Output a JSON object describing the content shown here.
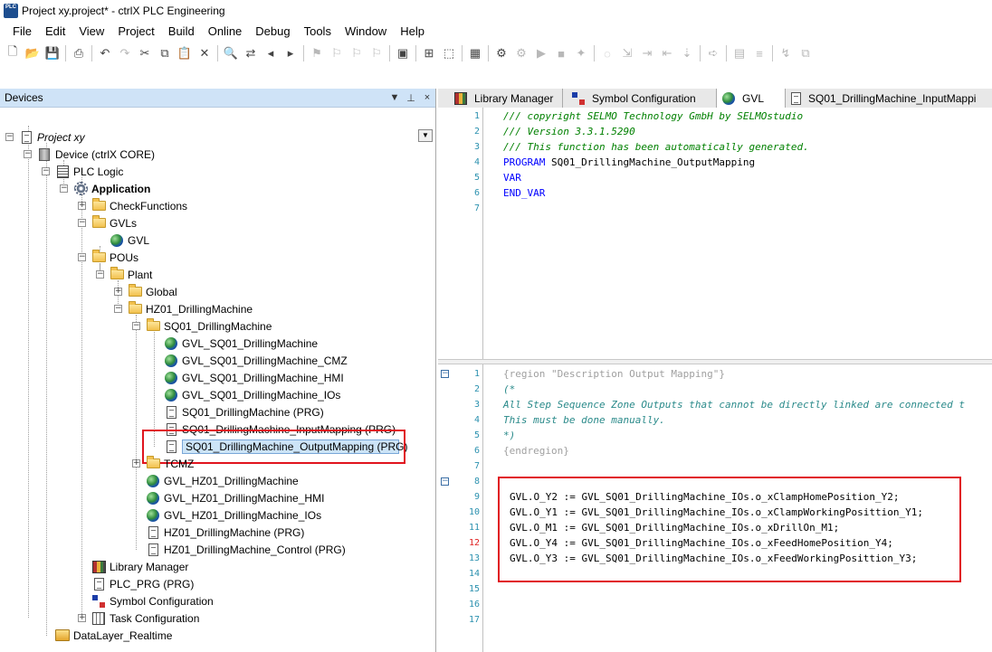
{
  "window": {
    "title": "Project xy.project* - ctrlX PLC Engineering",
    "app_icon_text": "PLC"
  },
  "menu": [
    "File",
    "Edit",
    "View",
    "Project",
    "Build",
    "Online",
    "Debug",
    "Tools",
    "Window",
    "Help"
  ],
  "devices": {
    "title": "Devices",
    "controls": {
      "dropdown": "▼",
      "pin": "⊥",
      "close": "×"
    },
    "dropdown_arrow": "▼",
    "tree": {
      "project": "Project xy",
      "device": "Device (ctrlX CORE)",
      "plc_logic": "PLC Logic",
      "application": "Application",
      "check_functions": "CheckFunctions",
      "gvls": "GVLs",
      "gvl": "GVL",
      "pous": "POUs",
      "plant": "Plant",
      "global": "Global",
      "hz01": "HZ01_DrillingMachine",
      "sq01": "SQ01_DrillingMachine",
      "gvl_sq01": "GVL_SQ01_DrillingMachine",
      "gvl_sq01_cmz": "GVL_SQ01_DrillingMachine_CMZ",
      "gvl_sq01_hmi": "GVL_SQ01_DrillingMachine_HMI",
      "gvl_sq01_ios": "GVL_SQ01_DrillingMachine_IOs",
      "sq01_prg": "SQ01_DrillingMachine (PRG)",
      "sq01_input": "SQ01_DrillingMachine_InputMapping (PRG)",
      "sq01_output": "SQ01_DrillingMachine_OutputMapping (PRG)",
      "tcmz": "TCMZ",
      "gvl_hz01": "GVL_HZ01_DrillingMachine",
      "gvl_hz01_hmi": "GVL_HZ01_DrillingMachine_HMI",
      "gvl_hz01_ios": "GVL_HZ01_DrillingMachine_IOs",
      "hz01_prg": "HZ01_DrillingMachine (PRG)",
      "hz01_control": "HZ01_DrillingMachine_Control (PRG)",
      "library_manager": "Library Manager",
      "plc_prg": "PLC_PRG (PRG)",
      "symbol_config": "Symbol Configuration",
      "task_config": "Task Configuration",
      "datalayer": "DataLayer_Realtime"
    }
  },
  "tabs": [
    {
      "label": "Library Manager",
      "icon": "library-icon"
    },
    {
      "label": "Symbol Configuration",
      "icon": "symbol-icon"
    },
    {
      "label": "GVL",
      "icon": "globe-icon"
    },
    {
      "label": "SQ01_DrillingMachine_InputMappi",
      "icon": "document-icon"
    }
  ],
  "declaration": {
    "lines": [
      {
        "n": "1",
        "text": "/// copyright SELMO Technology GmbH by SELMOstudio"
      },
      {
        "n": "2",
        "text": "/// Version 3.3.1.5290"
      },
      {
        "n": "3",
        "text": "/// This function has been automatically generated."
      },
      {
        "n": "4",
        "kw": "PROGRAM",
        "text": " SQ01_DrillingMachine_OutputMapping"
      },
      {
        "n": "5",
        "kw": "VAR",
        "text": ""
      },
      {
        "n": "6",
        "kw": "END_VAR",
        "text": ""
      },
      {
        "n": "7",
        "text": ""
      }
    ]
  },
  "implementation": {
    "lines": [
      {
        "n": "1",
        "text": "{region \"Description Output Mapping\"}"
      },
      {
        "n": "2",
        "text": "(*"
      },
      {
        "n": "3",
        "text": "All Step Sequence Zone Outputs that cannot be directly linked are connected t"
      },
      {
        "n": "4",
        "text": "This must be done manually."
      },
      {
        "n": "5",
        "text": "*)"
      },
      {
        "n": "6",
        "text": "{endregion}"
      },
      {
        "n": "7",
        "text": ""
      },
      {
        "n": "8",
        "text": ""
      },
      {
        "n": "9",
        "text": "GVL.O_Y2 := GVL_SQ01_DrillingMachine_IOs.o_xClampHomePosition_Y2;"
      },
      {
        "n": "10",
        "text": "GVL.O_Y1 := GVL_SQ01_DrillingMachine_IOs.o_xClampWorkingPosittion_Y1;"
      },
      {
        "n": "11",
        "text": "GVL.O_M1 := GVL_SQ01_DrillingMachine_IOs.o_xDrillOn_M1;"
      },
      {
        "n": "12",
        "text": "GVL.O_Y4 := GVL_SQ01_DrillingMachine_IOs.o_xFeedHomePosition_Y4;"
      },
      {
        "n": "13",
        "text": "GVL.O_Y3 := GVL_SQ01_DrillingMachine_IOs.o_xFeedWorkingPosittion_Y3;"
      },
      {
        "n": "14",
        "text": ""
      },
      {
        "n": "15",
        "text": ""
      },
      {
        "n": "16",
        "text": ""
      },
      {
        "n": "17",
        "text": ""
      }
    ]
  },
  "fold_markers": {
    "collapse": "−",
    "expand": "+"
  },
  "toolbar_icons": [
    "new-icon",
    "open-icon",
    "save-icon",
    "print-icon",
    "undo-icon",
    "redo-icon",
    "cut-icon",
    "copy-icon",
    "paste-icon",
    "delete-icon",
    "find-icon",
    "replace-icon",
    "find-prev-icon",
    "find-next-icon",
    "bookmark-icon",
    "bookmark-prev-icon",
    "bookmark-next-icon",
    "bookmark-clear-icon",
    "window-icon",
    "add-object-icon",
    "add-folder-icon",
    "build-icon",
    "login-icon",
    "logout-icon",
    "start-icon",
    "stop-icon",
    "step-icon",
    "breakpoint-icon",
    "step-over-icon",
    "step-into-icon",
    "step-out-icon",
    "run-to-cursor-icon",
    "next-statement-icon",
    "watch-icon",
    "write-values-icon",
    "force-values-icon",
    "unforce-icon"
  ],
  "colors": {
    "accent": "#cfe3f7",
    "highlight_box": "#e0141e",
    "comment": "#008000",
    "keyword": "#0000ff",
    "line_number": "#2b91af"
  }
}
